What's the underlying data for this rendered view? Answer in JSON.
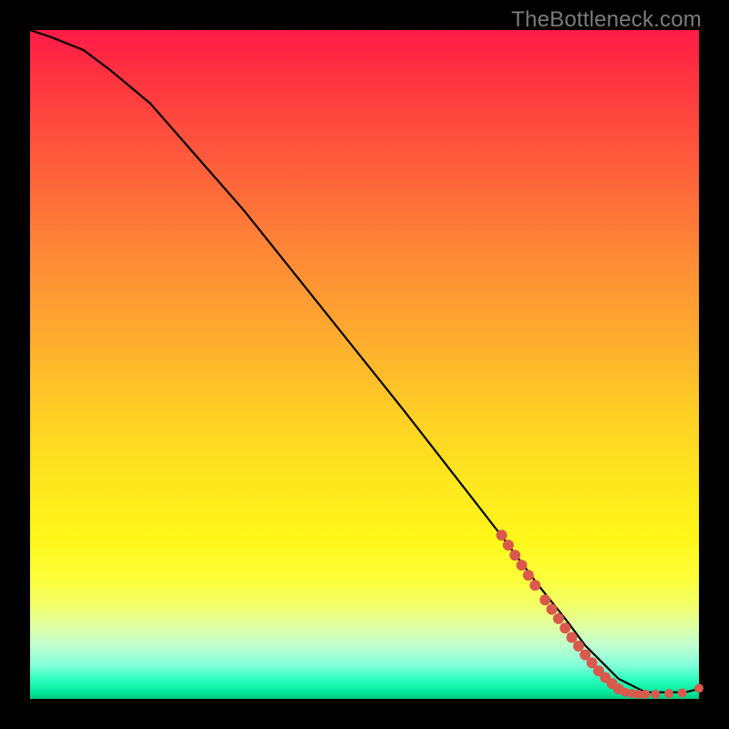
{
  "watermark": "TheBottleneck.com",
  "chart_data": {
    "type": "line",
    "title": "",
    "xlabel": "",
    "ylabel": "",
    "xlim": [
      0,
      100
    ],
    "ylim": [
      0,
      100
    ],
    "grid": false,
    "series": [
      {
        "name": "curve",
        "x": [
          0,
          3,
          8,
          12,
          18,
          25,
          32,
          40,
          48,
          56,
          63,
          70,
          76,
          80,
          83,
          86,
          88,
          90,
          92,
          94,
          96,
          98,
          100
        ],
        "y": [
          100,
          99,
          97,
          94,
          89,
          81,
          73,
          63,
          53,
          43,
          34,
          25,
          17,
          12,
          8,
          5,
          3,
          2,
          1,
          1,
          1,
          1,
          1.5
        ]
      }
    ],
    "markers": {
      "name": "dots",
      "color": "#d9594d",
      "points": [
        {
          "x": 70.5,
          "y": 24.5,
          "r": 6
        },
        {
          "x": 71.5,
          "y": 23.0,
          "r": 6
        },
        {
          "x": 72.5,
          "y": 21.5,
          "r": 6
        },
        {
          "x": 73.5,
          "y": 20.0,
          "r": 6
        },
        {
          "x": 74.5,
          "y": 18.5,
          "r": 6
        },
        {
          "x": 75.5,
          "y": 17.0,
          "r": 6
        },
        {
          "x": 77.0,
          "y": 14.8,
          "r": 6
        },
        {
          "x": 78.0,
          "y": 13.4,
          "r": 6
        },
        {
          "x": 79.0,
          "y": 12.0,
          "r": 6
        },
        {
          "x": 80.0,
          "y": 10.6,
          "r": 6
        },
        {
          "x": 81.0,
          "y": 9.2,
          "r": 6
        },
        {
          "x": 82.0,
          "y": 7.9,
          "r": 6
        },
        {
          "x": 83.0,
          "y": 6.6,
          "r": 6
        },
        {
          "x": 84.0,
          "y": 5.4,
          "r": 6
        },
        {
          "x": 85.0,
          "y": 4.2,
          "r": 6
        },
        {
          "x": 86.0,
          "y": 3.2,
          "r": 6
        },
        {
          "x": 87.0,
          "y": 2.3,
          "r": 6
        },
        {
          "x": 88.0,
          "y": 1.5,
          "r": 6
        },
        {
          "x": 89.0,
          "y": 1.0,
          "r": 5
        },
        {
          "x": 90.0,
          "y": 0.8,
          "r": 5
        },
        {
          "x": 91.0,
          "y": 0.7,
          "r": 5
        },
        {
          "x": 92.0,
          "y": 0.7,
          "r": 5
        },
        {
          "x": 93.5,
          "y": 0.7,
          "r": 5
        },
        {
          "x": 95.5,
          "y": 0.8,
          "r": 5
        },
        {
          "x": 97.5,
          "y": 0.9,
          "r": 5
        },
        {
          "x": 100.0,
          "y": 1.6,
          "r": 5
        }
      ]
    }
  }
}
